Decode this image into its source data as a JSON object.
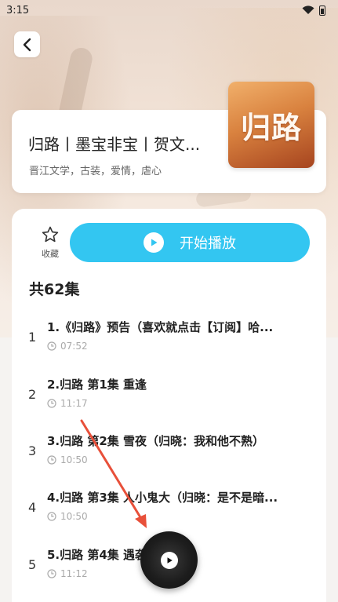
{
  "status_bar": {
    "time": "3:15"
  },
  "book": {
    "title": "归路丨墨宝非宝丨贺文...",
    "tags": "晋江文学，古装，爱情，虐心",
    "cover_text": "归路"
  },
  "actions": {
    "favorite_label": "收藏",
    "play_all_label": "开始播放"
  },
  "episode_count": "共62集",
  "episodes": [
    {
      "index": "1",
      "title": "1.《归路》预告（喜欢就点击【订阅】哈...",
      "duration": "07:52"
    },
    {
      "index": "2",
      "title": "2.归路 第1集 重逢",
      "duration": "11:17"
    },
    {
      "index": "3",
      "title": "3.归路 第2集 雪夜（归晓：我和他不熟）",
      "duration": "10:50"
    },
    {
      "index": "4",
      "title": "4.归路 第3集 人小鬼大（归晓：是不是暗...",
      "duration": "10:50"
    },
    {
      "index": "5",
      "title": "5.归路 第4集 遇袭",
      "duration": "11:12"
    }
  ],
  "colors": {
    "accent": "#33c6f1",
    "annotation_arrow": "#e8503a"
  },
  "icons": {
    "back": "chevron-left-icon",
    "favorite": "star-icon",
    "play": "play-icon",
    "clock": "clock-icon",
    "wifi": "wifi-icon",
    "battery": "battery-icon"
  }
}
